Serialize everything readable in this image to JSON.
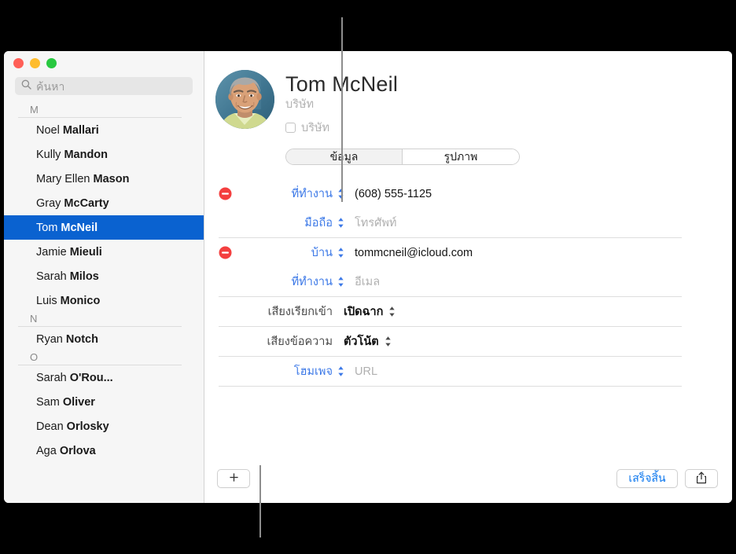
{
  "window": {
    "traffic_lights": [
      "close",
      "minimize",
      "zoom"
    ],
    "colors": {
      "close": "#ff5f57",
      "minimize": "#febc2e",
      "zoom": "#28c840",
      "selection": "#0a62d0",
      "accent_blue": "#3b78e7",
      "delete_red": "#f43f3f"
    }
  },
  "sidebar": {
    "search": {
      "placeholder": "ค้นหา",
      "value": "",
      "icon": "search-icon"
    },
    "sections": [
      {
        "letter": "M",
        "contacts": [
          {
            "first": "Noel",
            "last": "Mallari",
            "selected": false
          },
          {
            "first": "Kully",
            "last": "Mandon",
            "selected": false
          },
          {
            "first": "Mary Ellen",
            "last": "Mason",
            "selected": false
          },
          {
            "first": "Gray",
            "last": "McCarty",
            "selected": false
          },
          {
            "first": "Tom",
            "last": "McNeil",
            "selected": true
          },
          {
            "first": "Jamie",
            "last": "Mieuli",
            "selected": false
          },
          {
            "first": "Sarah",
            "last": "Milos",
            "selected": false
          },
          {
            "first": "Luis",
            "last": "Monico",
            "selected": false
          }
        ]
      },
      {
        "letter": "N",
        "contacts": [
          {
            "first": "Ryan",
            "last": "Notch",
            "selected": false
          }
        ]
      },
      {
        "letter": "O",
        "contacts": [
          {
            "first": "Sarah",
            "last": "O'Rou...",
            "selected": false
          },
          {
            "first": "Sam",
            "last": "Oliver",
            "selected": false
          },
          {
            "first": "Dean",
            "last": "Orlosky",
            "selected": false
          },
          {
            "first": "Aga",
            "last": "Orlova",
            "selected": false
          }
        ]
      }
    ]
  },
  "detail": {
    "avatar": "contact-photo",
    "name": "Tom  McNeil",
    "company_placeholder": "บริษัท",
    "company_checkbox_label": "บริษัท",
    "company_checked": false,
    "tabs": [
      {
        "label": "ข้อมูล",
        "active": true
      },
      {
        "label": "รูปภาพ",
        "active": false
      }
    ],
    "groups": [
      {
        "name": "phone-group",
        "rows": [
          {
            "type": "editable",
            "deletable": true,
            "label": "ที่ทำงาน",
            "label_blue": true,
            "value": "(608) 555-1125",
            "is_placeholder": false
          },
          {
            "type": "editable",
            "deletable": false,
            "label": "มือถือ",
            "label_blue": true,
            "value": "โทรศัพท์",
            "is_placeholder": true
          }
        ]
      },
      {
        "name": "email-group",
        "rows": [
          {
            "type": "editable",
            "deletable": true,
            "label": "บ้าน",
            "label_blue": true,
            "value": "tommcneil@icloud.com",
            "is_placeholder": false
          },
          {
            "type": "editable",
            "deletable": false,
            "label": "ที่ทำงาน",
            "label_blue": true,
            "value": "อีเมล",
            "is_placeholder": true
          }
        ]
      },
      {
        "name": "ringtone-group",
        "rows": [
          {
            "type": "popup",
            "deletable": false,
            "label": "เสียงเรียกเข้า",
            "label_blue": false,
            "value": "เปิดฉาก",
            "is_placeholder": false
          }
        ]
      },
      {
        "name": "texttone-group",
        "rows": [
          {
            "type": "popup",
            "deletable": false,
            "label": "เสียงข้อความ",
            "label_blue": false,
            "value": "ตัวโน้ต",
            "is_placeholder": false
          }
        ]
      },
      {
        "name": "homepage-group",
        "rows": [
          {
            "type": "editable",
            "deletable": false,
            "label": "โฮมเพจ",
            "label_blue": true,
            "value": "URL",
            "is_placeholder": true
          }
        ]
      }
    ],
    "footer": {
      "add_label": "+",
      "add_icon": "plus-icon",
      "done_label": "เสร็จสิ้น",
      "share_icon": "share-icon"
    }
  }
}
